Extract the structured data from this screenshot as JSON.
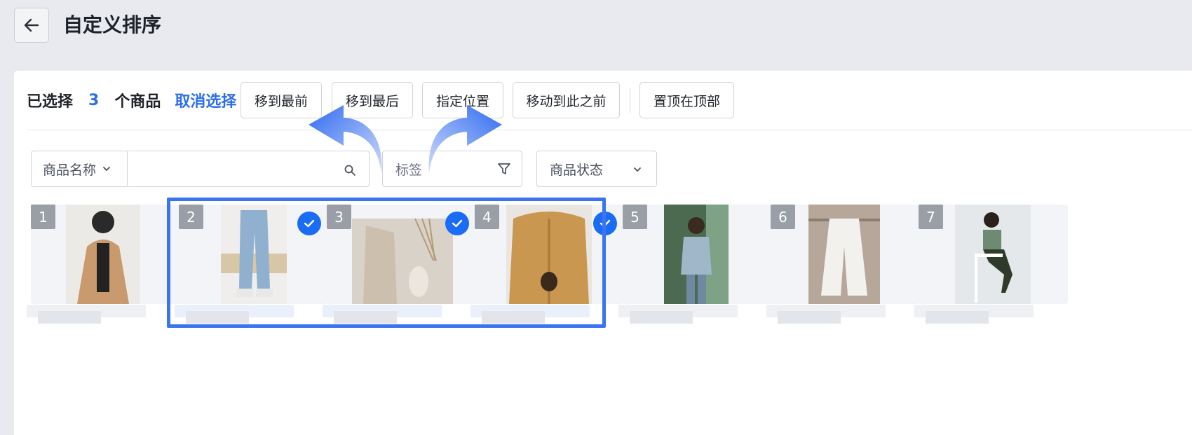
{
  "header": {
    "back_icon": "arrow-left-icon",
    "title": "自定义排序"
  },
  "selection": {
    "prefix": "已选择",
    "count": "3",
    "suffix": "个商品",
    "cancel": "取消选择"
  },
  "actions": {
    "move_first": "移到最前",
    "move_last": "移到最后",
    "set_position": "指定位置",
    "move_before": "移动到此之前",
    "pin_top": "置顶在顶部"
  },
  "filters": {
    "name_field": "商品名称",
    "name_input_value": "",
    "tag_placeholder": "标签",
    "status": "商品状态"
  },
  "products": [
    {
      "index": "1",
      "selected": false
    },
    {
      "index": "2",
      "selected": true
    },
    {
      "index": "3",
      "selected": true
    },
    {
      "index": "4",
      "selected": true
    },
    {
      "index": "5",
      "selected": false
    },
    {
      "index": "6",
      "selected": false
    },
    {
      "index": "7",
      "selected": false
    }
  ],
  "colors": {
    "accent": "#2d6fea",
    "selection_border": "#3b74f1",
    "check": "#1a6cf5"
  }
}
